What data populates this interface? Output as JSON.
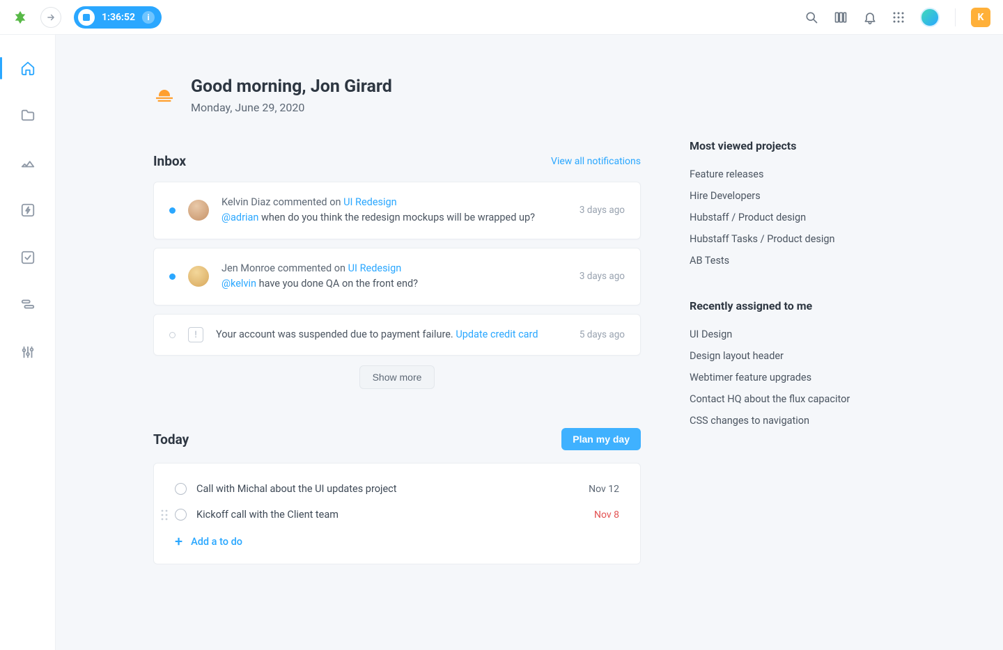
{
  "topbar": {
    "timer": "1:36:52",
    "org_initial": "K"
  },
  "greeting": {
    "title": "Good morning, Jon Girard",
    "date": "Monday, June 29, 2020"
  },
  "inbox": {
    "title": "Inbox",
    "view_all_label": "View all notifications",
    "show_more_label": "Show more",
    "items": [
      {
        "unread": true,
        "author": "Kelvin Diaz",
        "action": " commented on ",
        "link": "UI Redesign",
        "mention": "@adrian",
        "body": " when do you think the redesign mockups will be wrapped up?",
        "time": "3 days ago"
      },
      {
        "unread": true,
        "author": "Jen Monroe",
        "action": " commented on ",
        "link": "UI Redesign",
        "mention": "@kelvin",
        "body": " have you done QA on the front end?",
        "time": "3 days ago"
      },
      {
        "system_text": "Your account was suspended due to payment failure. ",
        "system_link": "Update credit card",
        "time": "5 days ago"
      }
    ]
  },
  "today": {
    "title": "Today",
    "plan_label": "Plan my day",
    "add_label": "Add a to do",
    "items": [
      {
        "text": "Call with Michal about the UI updates project",
        "date": "Nov 12",
        "overdue": false,
        "grip": false
      },
      {
        "text": "Kickoff call with the Client team",
        "date": "Nov 8",
        "overdue": true,
        "grip": true
      }
    ]
  },
  "right": {
    "most_viewed_title": "Most viewed projects",
    "most_viewed": [
      "Feature releases",
      "Hire Developers",
      "Hubstaff / Product design",
      "Hubstaff Tasks / Product design",
      "AB Tests"
    ],
    "recent_title": "Recently assigned to me",
    "recent": [
      "UI Design",
      "Design layout header",
      "Webtimer feature upgrades",
      "Contact HQ about the flux capacitor",
      "CSS changes to navigation"
    ]
  }
}
